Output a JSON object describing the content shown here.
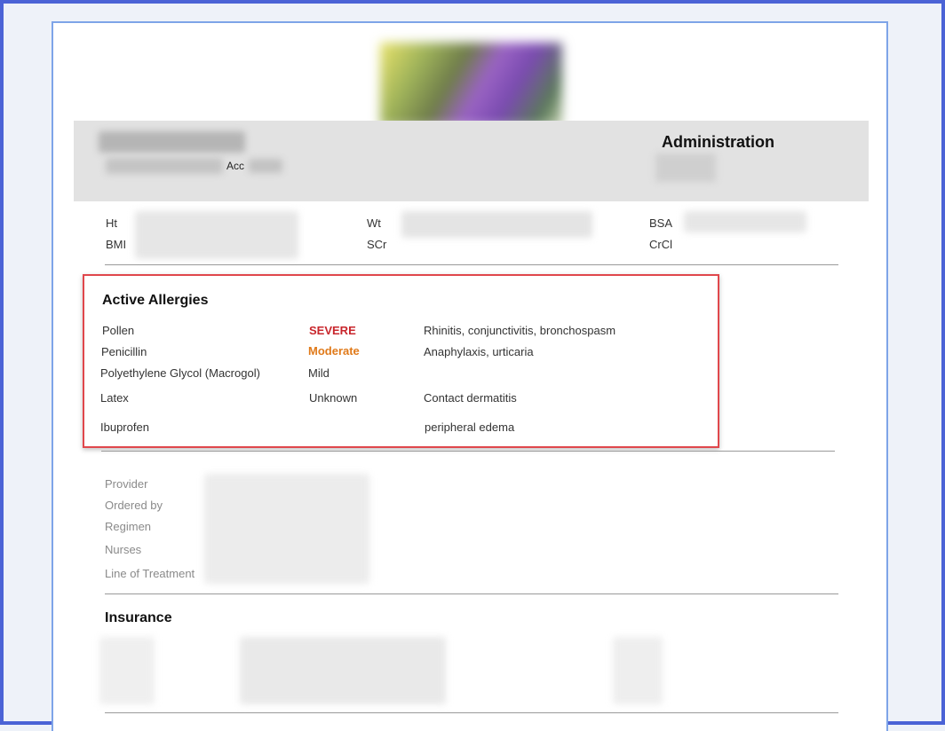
{
  "header": {
    "title": "Administration",
    "acc_label": "Acc"
  },
  "vitals": {
    "ht": "Ht",
    "bmi": "BMI",
    "wt": "Wt",
    "scr": "SCr",
    "bsa": "BSA",
    "crcl": "CrCl"
  },
  "allergies": {
    "title": "Active Allergies",
    "rows": [
      {
        "name": "Pollen",
        "severity": "SEVERE",
        "reaction": "Rhinitis, conjunctivitis, bronchospasm"
      },
      {
        "name": "Penicillin",
        "severity": "Moderate",
        "reaction": "Anaphylaxis, urticaria"
      },
      {
        "name": "Polyethylene Glycol (Macrogol)",
        "severity": "Mild",
        "reaction": ""
      },
      {
        "name": "Latex",
        "severity": "Unknown",
        "reaction": "Contact dermatitis"
      },
      {
        "name": "Ibuprofen",
        "severity": "",
        "reaction": "peripheral edema"
      }
    ],
    "colors": {
      "severe": "#c8262c",
      "moderate": "#e07a1a",
      "border": "#e0474c"
    }
  },
  "care_team": {
    "provider": "Provider",
    "ordered_by": "Ordered by",
    "regimen": "Regimen",
    "nurses": "Nurses",
    "line_of_treatment": "Line of Treatment"
  },
  "insurance": {
    "title": "Insurance"
  }
}
